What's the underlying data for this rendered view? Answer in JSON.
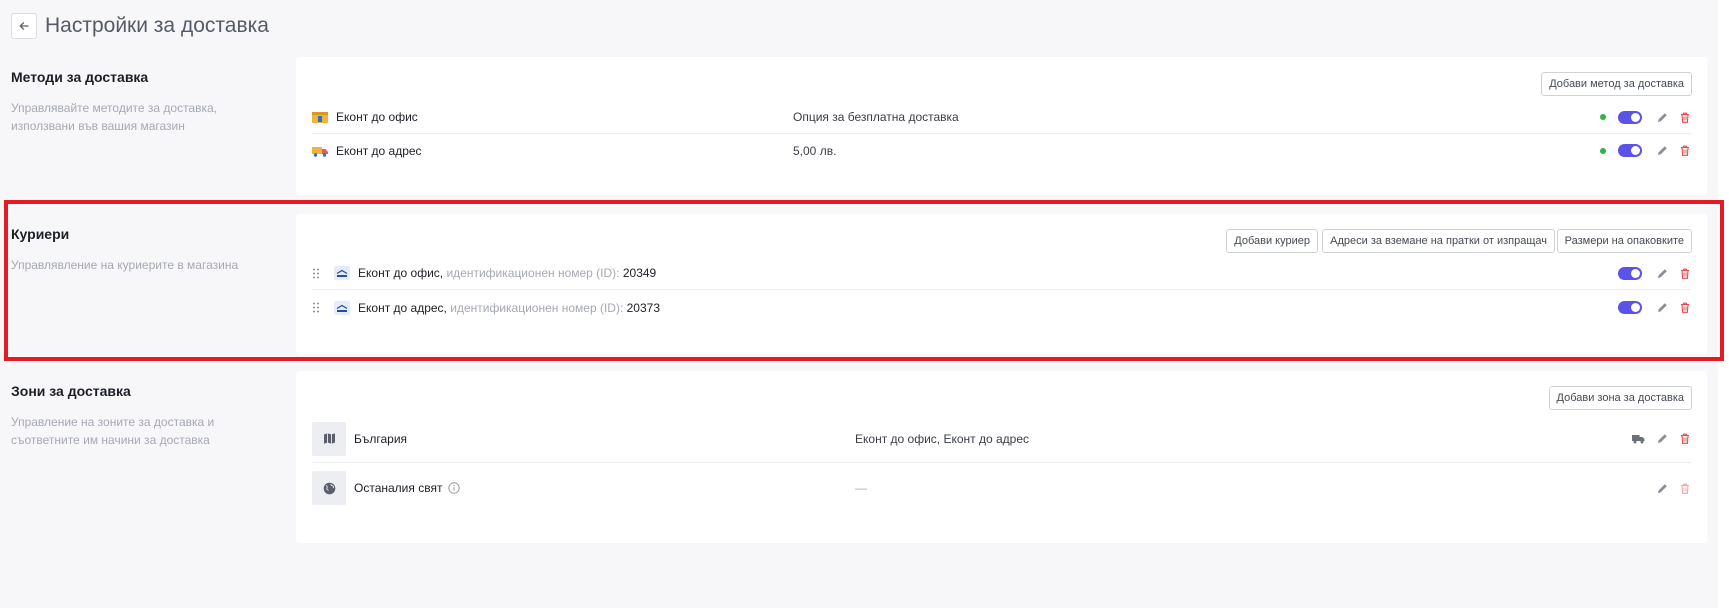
{
  "header": {
    "title": "Настройки за доставка"
  },
  "methods": {
    "title": "Методи за доставка",
    "description": "Управлявайте методите за доставка, използвани във вашия магазин",
    "add_button": "Добави метод за доставка",
    "items": [
      {
        "name": "Еконт до офис",
        "detail": "Опция за безплатна доставка"
      },
      {
        "name": "Еконт до адрес",
        "detail": "5,00 лв."
      }
    ]
  },
  "couriers": {
    "title": "Куриери",
    "description": "Управлявление на куриерите в магазина",
    "buttons": {
      "add_courier": "Добави куриер",
      "pickup_addresses": "Адреси за вземане на пратки от изпращач",
      "package_sizes": "Размери на опаковките"
    },
    "items": [
      {
        "name": "Еконт до офис,",
        "id_label": "идентификационен номер (ID):",
        "id": "20349"
      },
      {
        "name": "Еконт до адрес,",
        "id_label": "идентификационен номер (ID):",
        "id": "20373"
      }
    ]
  },
  "zones": {
    "title": "Зони за доставка",
    "description": "Управление на зоните за доставка и съответните им начини за доставка",
    "add_button": "Добави зона за доставка",
    "items": [
      {
        "name": "България",
        "methods": "Еконт до офис, Еконт до адрес",
        "icon": "map-icon"
      },
      {
        "name": "Останалия свят",
        "methods": "—",
        "icon": "globe-icon"
      }
    ]
  },
  "colors": {
    "accent": "#5b52e8",
    "active_dot": "#2fb344",
    "danger": "#e5484d",
    "highlight": "#e31b23"
  }
}
